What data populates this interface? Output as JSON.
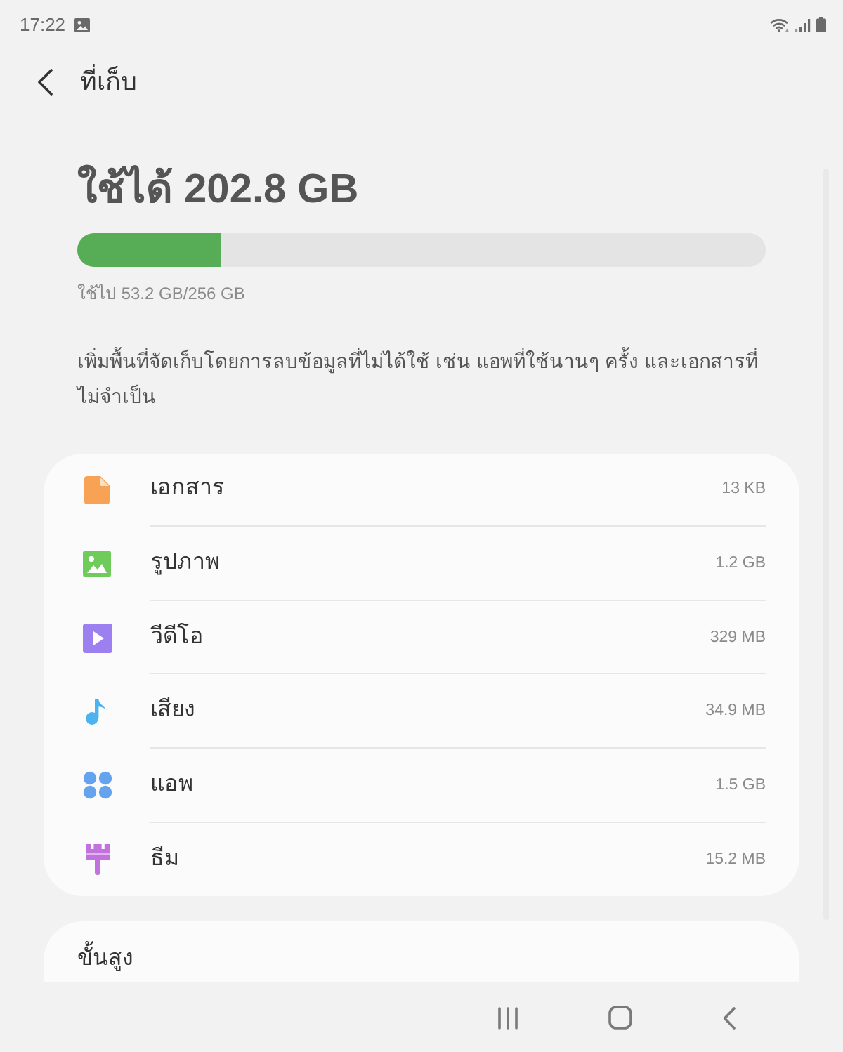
{
  "status_bar": {
    "time": "17:22"
  },
  "header": {
    "title": "ที่เก็บ"
  },
  "storage": {
    "available": "ใช้ได้ 202.8 GB",
    "level": 0.208,
    "used": "ใช้ไป 53.2 GB/256 GB"
  },
  "description": "เพิ่มพื้นที่จัดเก็บโดยการลบข้อมูลที่ไม่ได้ใช้ เช่น แอพที่ใช้นานๆ ครั้ง และเอกสารที่ไม่จำเป็น",
  "categories": [
    {
      "kind": "documents",
      "label": "เอกสาร",
      "size": "13 KB"
    },
    {
      "kind": "images",
      "label": "รูปภาพ",
      "size": "1.2 GB"
    },
    {
      "kind": "videos",
      "label": "วีดีโอ",
      "size": "329 MB"
    },
    {
      "kind": "audio",
      "label": "เสียง",
      "size": "34.9 MB"
    },
    {
      "kind": "apps",
      "label": "แอพ",
      "size": "1.5 GB"
    },
    {
      "kind": "themes",
      "label": "ธีม",
      "size": "15.2 MB"
    }
  ],
  "advanced": {
    "label": "ขั้นสูง"
  }
}
